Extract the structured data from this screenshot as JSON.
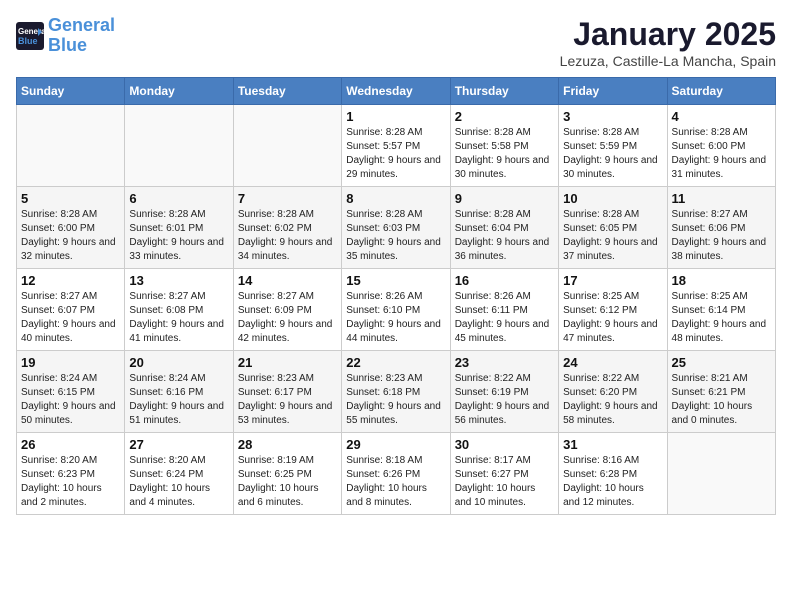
{
  "header": {
    "logo_line1": "General",
    "logo_line2": "Blue",
    "title": "January 2025",
    "subtitle": "Lezuza, Castille-La Mancha, Spain"
  },
  "weekdays": [
    "Sunday",
    "Monday",
    "Tuesday",
    "Wednesday",
    "Thursday",
    "Friday",
    "Saturday"
  ],
  "weeks": [
    [
      {
        "day": "",
        "info": ""
      },
      {
        "day": "",
        "info": ""
      },
      {
        "day": "",
        "info": ""
      },
      {
        "day": "1",
        "info": "Sunrise: 8:28 AM\nSunset: 5:57 PM\nDaylight: 9 hours\nand 29 minutes."
      },
      {
        "day": "2",
        "info": "Sunrise: 8:28 AM\nSunset: 5:58 PM\nDaylight: 9 hours\nand 30 minutes."
      },
      {
        "day": "3",
        "info": "Sunrise: 8:28 AM\nSunset: 5:59 PM\nDaylight: 9 hours\nand 30 minutes."
      },
      {
        "day": "4",
        "info": "Sunrise: 8:28 AM\nSunset: 6:00 PM\nDaylight: 9 hours\nand 31 minutes."
      }
    ],
    [
      {
        "day": "5",
        "info": "Sunrise: 8:28 AM\nSunset: 6:00 PM\nDaylight: 9 hours\nand 32 minutes."
      },
      {
        "day": "6",
        "info": "Sunrise: 8:28 AM\nSunset: 6:01 PM\nDaylight: 9 hours\nand 33 minutes."
      },
      {
        "day": "7",
        "info": "Sunrise: 8:28 AM\nSunset: 6:02 PM\nDaylight: 9 hours\nand 34 minutes."
      },
      {
        "day": "8",
        "info": "Sunrise: 8:28 AM\nSunset: 6:03 PM\nDaylight: 9 hours\nand 35 minutes."
      },
      {
        "day": "9",
        "info": "Sunrise: 8:28 AM\nSunset: 6:04 PM\nDaylight: 9 hours\nand 36 minutes."
      },
      {
        "day": "10",
        "info": "Sunrise: 8:28 AM\nSunset: 6:05 PM\nDaylight: 9 hours\nand 37 minutes."
      },
      {
        "day": "11",
        "info": "Sunrise: 8:27 AM\nSunset: 6:06 PM\nDaylight: 9 hours\nand 38 minutes."
      }
    ],
    [
      {
        "day": "12",
        "info": "Sunrise: 8:27 AM\nSunset: 6:07 PM\nDaylight: 9 hours\nand 40 minutes."
      },
      {
        "day": "13",
        "info": "Sunrise: 8:27 AM\nSunset: 6:08 PM\nDaylight: 9 hours\nand 41 minutes."
      },
      {
        "day": "14",
        "info": "Sunrise: 8:27 AM\nSunset: 6:09 PM\nDaylight: 9 hours\nand 42 minutes."
      },
      {
        "day": "15",
        "info": "Sunrise: 8:26 AM\nSunset: 6:10 PM\nDaylight: 9 hours\nand 44 minutes."
      },
      {
        "day": "16",
        "info": "Sunrise: 8:26 AM\nSunset: 6:11 PM\nDaylight: 9 hours\nand 45 minutes."
      },
      {
        "day": "17",
        "info": "Sunrise: 8:25 AM\nSunset: 6:12 PM\nDaylight: 9 hours\nand 47 minutes."
      },
      {
        "day": "18",
        "info": "Sunrise: 8:25 AM\nSunset: 6:14 PM\nDaylight: 9 hours\nand 48 minutes."
      }
    ],
    [
      {
        "day": "19",
        "info": "Sunrise: 8:24 AM\nSunset: 6:15 PM\nDaylight: 9 hours\nand 50 minutes."
      },
      {
        "day": "20",
        "info": "Sunrise: 8:24 AM\nSunset: 6:16 PM\nDaylight: 9 hours\nand 51 minutes."
      },
      {
        "day": "21",
        "info": "Sunrise: 8:23 AM\nSunset: 6:17 PM\nDaylight: 9 hours\nand 53 minutes."
      },
      {
        "day": "22",
        "info": "Sunrise: 8:23 AM\nSunset: 6:18 PM\nDaylight: 9 hours\nand 55 minutes."
      },
      {
        "day": "23",
        "info": "Sunrise: 8:22 AM\nSunset: 6:19 PM\nDaylight: 9 hours\nand 56 minutes."
      },
      {
        "day": "24",
        "info": "Sunrise: 8:22 AM\nSunset: 6:20 PM\nDaylight: 9 hours\nand 58 minutes."
      },
      {
        "day": "25",
        "info": "Sunrise: 8:21 AM\nSunset: 6:21 PM\nDaylight: 10 hours\nand 0 minutes."
      }
    ],
    [
      {
        "day": "26",
        "info": "Sunrise: 8:20 AM\nSunset: 6:23 PM\nDaylight: 10 hours\nand 2 minutes."
      },
      {
        "day": "27",
        "info": "Sunrise: 8:20 AM\nSunset: 6:24 PM\nDaylight: 10 hours\nand 4 minutes."
      },
      {
        "day": "28",
        "info": "Sunrise: 8:19 AM\nSunset: 6:25 PM\nDaylight: 10 hours\nand 6 minutes."
      },
      {
        "day": "29",
        "info": "Sunrise: 8:18 AM\nSunset: 6:26 PM\nDaylight: 10 hours\nand 8 minutes."
      },
      {
        "day": "30",
        "info": "Sunrise: 8:17 AM\nSunset: 6:27 PM\nDaylight: 10 hours\nand 10 minutes."
      },
      {
        "day": "31",
        "info": "Sunrise: 8:16 AM\nSunset: 6:28 PM\nDaylight: 10 hours\nand 12 minutes."
      },
      {
        "day": "",
        "info": ""
      }
    ]
  ]
}
